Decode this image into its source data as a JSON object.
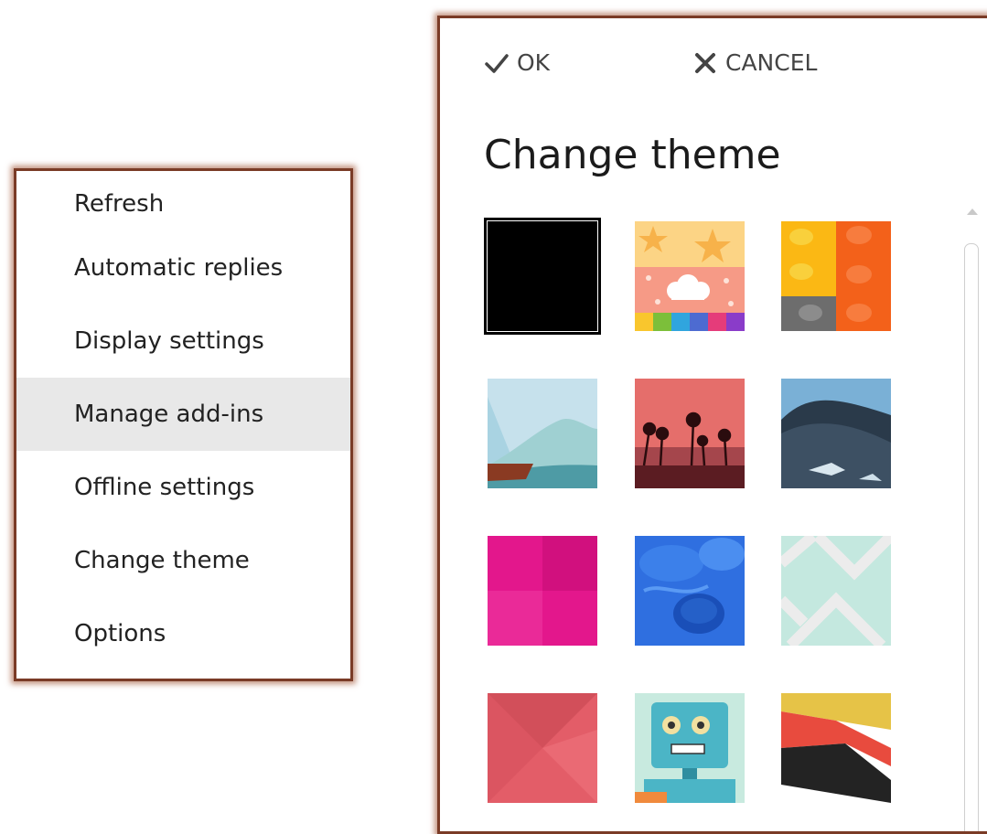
{
  "menu": {
    "items": [
      {
        "label": "Refresh"
      },
      {
        "label": "Automatic replies"
      },
      {
        "label": "Display settings"
      },
      {
        "label": "Manage add-ins",
        "highlighted": true
      },
      {
        "label": "Offline settings"
      },
      {
        "label": "Change theme"
      },
      {
        "label": "Options"
      }
    ]
  },
  "panel": {
    "ok_label": "OK",
    "cancel_label": "CANCEL",
    "ok_icon": "checkmark-icon",
    "cancel_icon": "close-icon",
    "title": "Change theme",
    "themes": [
      {
        "name": "black",
        "selected": true
      },
      {
        "name": "stars-clouds"
      },
      {
        "name": "building-blocks"
      },
      {
        "name": "wave"
      },
      {
        "name": "palm-trees-sunset"
      },
      {
        "name": "mountain"
      },
      {
        "name": "magenta"
      },
      {
        "name": "blue-jellyfish"
      },
      {
        "name": "mint-chevron"
      },
      {
        "name": "red-geometric"
      },
      {
        "name": "robot"
      },
      {
        "name": "colorful-layers"
      }
    ]
  },
  "colors": {
    "frame_border": "#7a3b26",
    "menu_highlight": "#e8e8e8"
  }
}
